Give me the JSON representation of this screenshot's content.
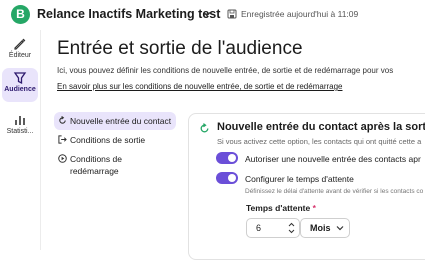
{
  "header": {
    "logo_letter": "B",
    "app_title": "Relance Inactifs Marketing test",
    "save_status": "Enregistrée aujourd'hui à 11:09"
  },
  "sidebar": {
    "items": [
      {
        "label": "Éditeur",
        "icon": "editor-icon",
        "active": false
      },
      {
        "label": "Audience",
        "icon": "audience-icon",
        "active": true
      },
      {
        "label": "Statisti...",
        "icon": "stats-icon",
        "active": false
      }
    ]
  },
  "main": {
    "title": "Entrée et sortie de l'audience",
    "intro": "Ici, vous pouvez définir les conditions de nouvelle entrée, de sortie et de redémarrage pour vos",
    "learn_more": "En savoir plus sur les conditions de nouvelle entrée, de sortie et de redémarrage"
  },
  "subnav": {
    "items": [
      {
        "label": "Nouvelle entrée du contact",
        "icon": "refresh-icon",
        "active": true
      },
      {
        "label": "Conditions de sortie",
        "icon": "exit-icon",
        "active": false
      },
      {
        "label": "Conditions de redémarrage",
        "icon": "play-circle-icon",
        "active": false
      }
    ]
  },
  "card": {
    "title": "Nouvelle entrée du contact après la sortie",
    "subtitle": "Si vous activez cette option, les contacts qui ont quitté cette a",
    "toggle_reentry_label": "Autoriser une nouvelle entrée des contacts apr",
    "toggle_reentry_on": true,
    "toggle_wait_label": "Configurer le temps d'attente",
    "toggle_wait_on": true,
    "wait_hint": "Définissez le délai d'attente avant de vérifier si les contacts co",
    "wait_field_label": "Temps d'attente",
    "wait_required_mark": "*",
    "wait_value": "6",
    "wait_unit": "Mois"
  },
  "colors": {
    "brand_green": "#25a766",
    "accent_purple": "#6b4fd8",
    "active_bg": "#e9e4fb"
  }
}
